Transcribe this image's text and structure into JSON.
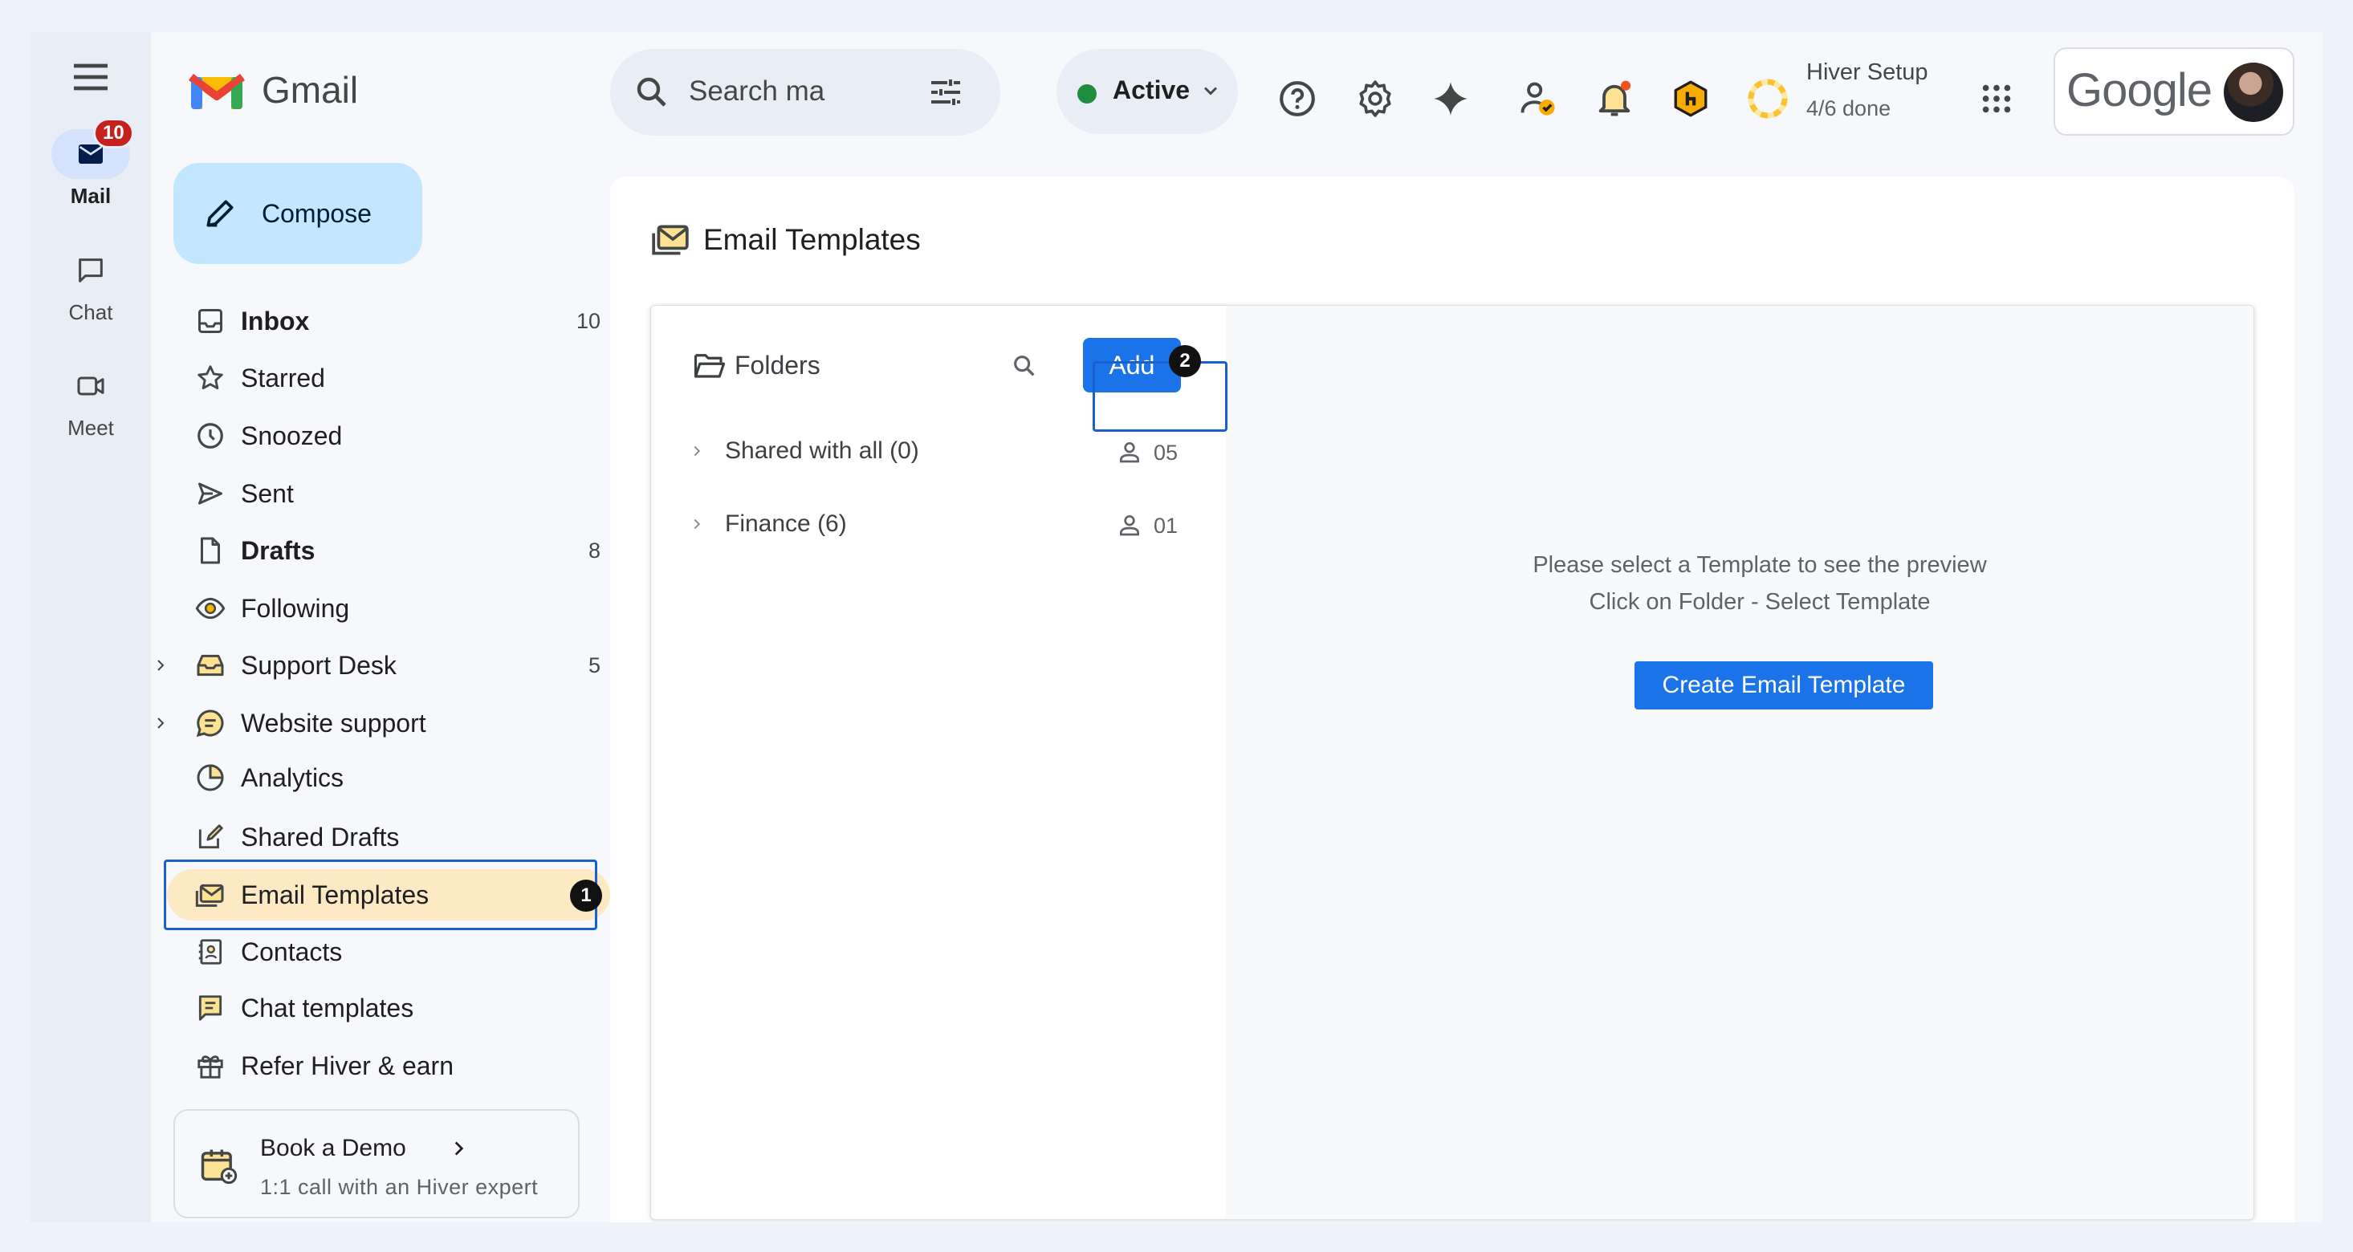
{
  "app": {
    "logo_text": "Gmail",
    "search_placeholder": "Search ma"
  },
  "rail": {
    "mail": {
      "label": "Mail",
      "badge": "10"
    },
    "chat": {
      "label": "Chat"
    },
    "meet": {
      "label": "Meet"
    }
  },
  "compose": {
    "label": "Compose"
  },
  "nav": [
    {
      "name": "Inbox",
      "count": "10",
      "icon": "inbox-icon"
    },
    {
      "name": "Starred",
      "count": "",
      "icon": "star-icon"
    },
    {
      "name": "Snoozed",
      "count": "",
      "icon": "clock-icon"
    },
    {
      "name": "Sent",
      "count": "",
      "icon": "send-icon"
    },
    {
      "name": "Drafts",
      "count": "8",
      "icon": "draft-icon"
    },
    {
      "name": "Following",
      "count": "",
      "icon": "eye-icon"
    },
    {
      "name": "Support Desk",
      "count": "5",
      "icon": "shared-inbox-icon"
    },
    {
      "name": "Website support",
      "count": "",
      "icon": "chat-bubble-icon"
    },
    {
      "name": "Analytics",
      "count": "",
      "icon": "pie-chart-icon"
    },
    {
      "name": "Shared Drafts",
      "count": "",
      "icon": "edit-square-icon"
    },
    {
      "name": "Email Templates",
      "count": "",
      "icon": "mail-template-icon"
    },
    {
      "name": "Contacts",
      "count": "",
      "icon": "contacts-icon"
    },
    {
      "name": "Chat templates",
      "count": "",
      "icon": "chat-template-icon"
    },
    {
      "name": "Refer Hiver & earn",
      "count": "",
      "icon": "gift-icon"
    }
  ],
  "demo": {
    "title": "Book a Demo",
    "subtitle": "1:1 call with an Hiver expert"
  },
  "status": {
    "label": "Active",
    "color": "#1e8e3e"
  },
  "setup": {
    "title": "Hiver Setup",
    "progress_text": "4/6 done"
  },
  "account": {
    "brand": "Google"
  },
  "steps": {
    "one": "1",
    "two": "2"
  },
  "templates": {
    "title": "Email Templates",
    "folders_label": "Folders",
    "add_label": "Add",
    "folders": [
      {
        "name": "Shared with all (0)",
        "users": "05"
      },
      {
        "name": "Finance (6)",
        "users": "01"
      }
    ],
    "preview_line1": "Please select a Template to see the preview",
    "preview_line2": "Click on Folder - Select Template",
    "create_label": "Create Email Template"
  },
  "colors": {
    "accent": "#1a73e8",
    "selected_bg": "#fde9c4",
    "compose_bg": "#c2e7ff",
    "highlight_border": "#1a5fd0"
  }
}
